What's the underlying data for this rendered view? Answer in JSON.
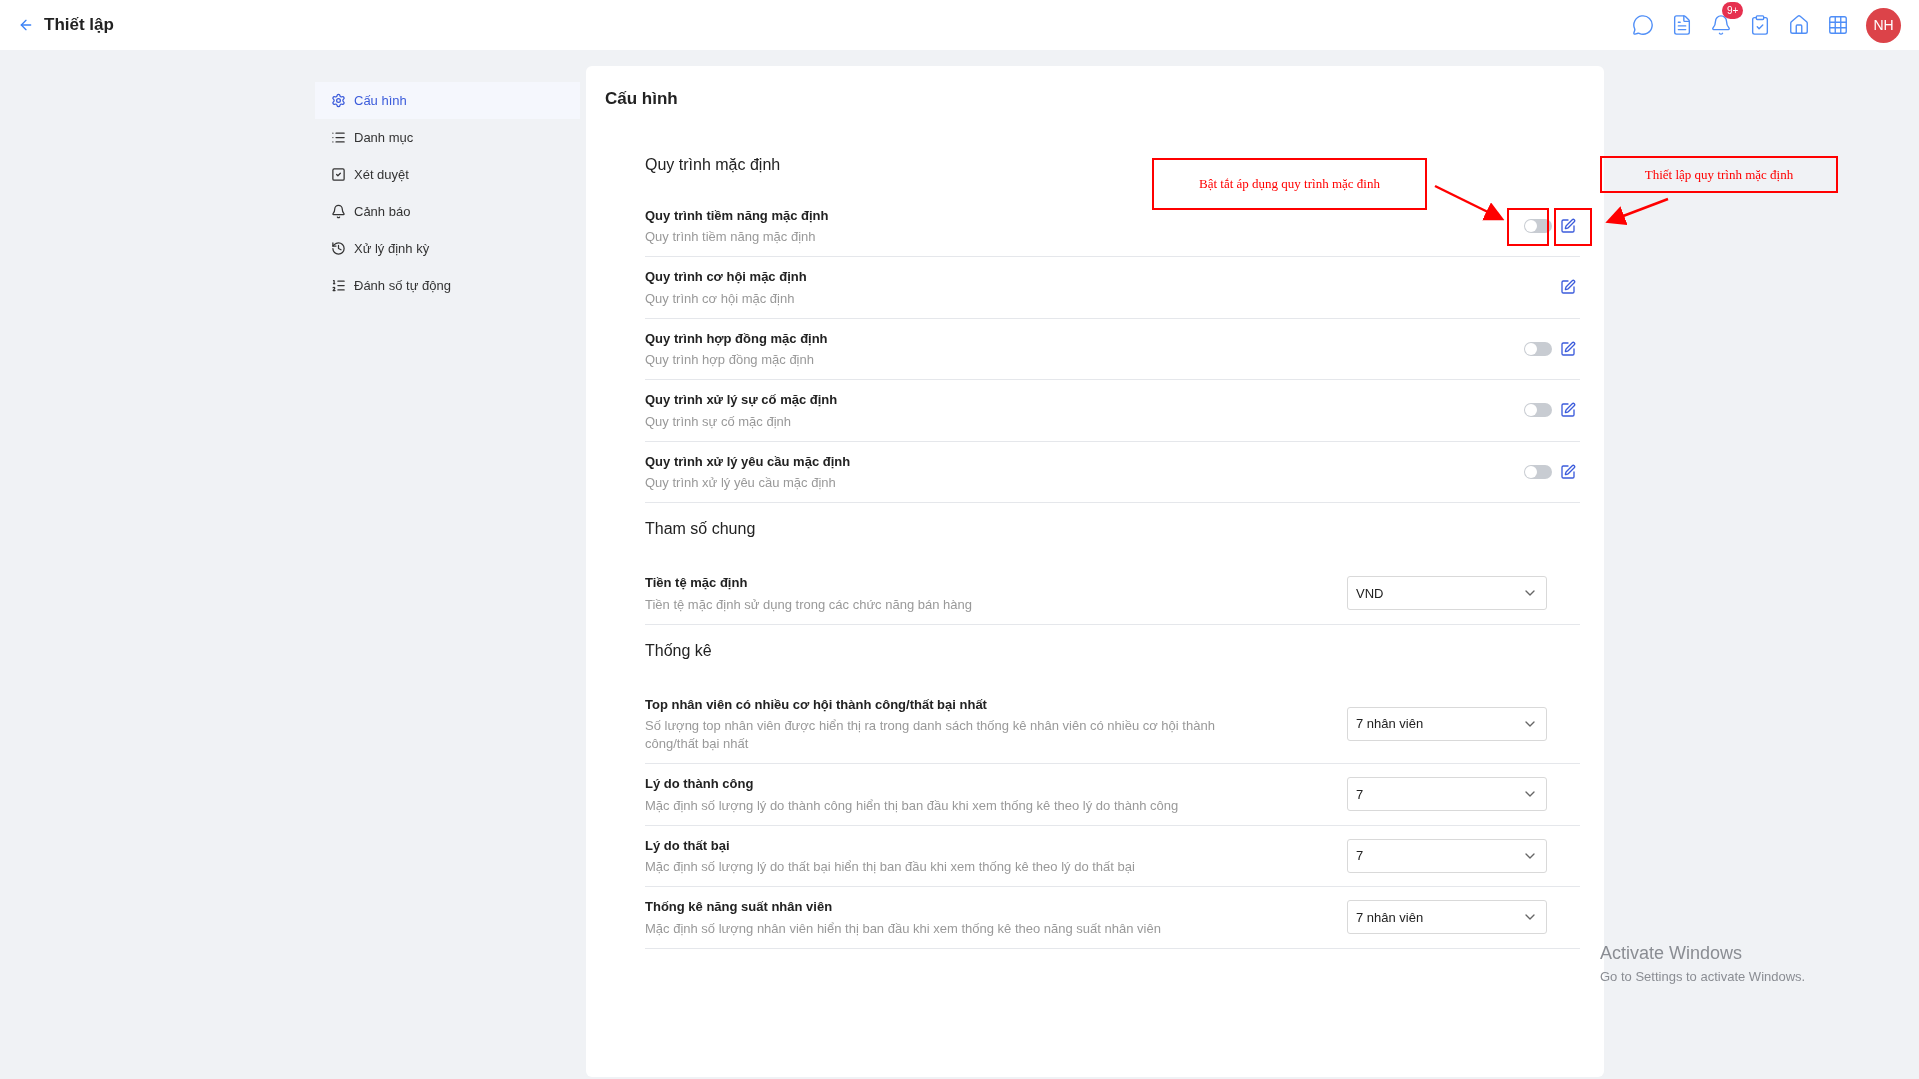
{
  "header": {
    "title": "Thiết lập",
    "notification_badge": "9+",
    "avatar_initials": "NH"
  },
  "sidebar": {
    "items": [
      {
        "label": "Cấu hình",
        "selected": true
      },
      {
        "label": "Danh mục",
        "selected": false
      },
      {
        "label": "Xét duyệt",
        "selected": false
      },
      {
        "label": "Cảnh báo",
        "selected": false
      },
      {
        "label": "Xử lý định kỳ",
        "selected": false
      },
      {
        "label": "Đánh số tự động",
        "selected": false
      }
    ]
  },
  "panel": {
    "title": "Cấu hình",
    "sections": [
      {
        "title": "Quy trình mặc định",
        "rows": [
          {
            "kind": "toggle_edit",
            "label": "Quy trình tiềm năng mặc định",
            "description": "Quy trình tiềm năng mặc định",
            "on": false
          },
          {
            "kind": "edit",
            "label": "Quy trình cơ hội mặc định",
            "description": "Quy trình cơ hội mặc định"
          },
          {
            "kind": "toggle_edit",
            "label": "Quy trình hợp đồng mặc định",
            "description": "Quy trình hợp đồng mặc định",
            "on": false
          },
          {
            "kind": "toggle_edit",
            "label": "Quy trình xử lý sự cố mặc định",
            "description": "Quy trình sự cố mặc định",
            "on": false
          },
          {
            "kind": "toggle_edit",
            "label": "Quy trình xử lý yêu cầu mặc định",
            "description": "Quy trình xử lý yêu cầu mặc định",
            "on": false
          }
        ]
      },
      {
        "title": "Tham số chung",
        "rows": [
          {
            "kind": "select",
            "label": "Tiền tệ mặc định",
            "description": "Tiền tệ mặc định sử dụng trong các chức năng bán hàng",
            "value": "VND"
          }
        ]
      },
      {
        "title": "Thống kê",
        "rows": [
          {
            "kind": "select",
            "label": "Top nhân viên có nhiều cơ hội thành công/thất bại nhất",
            "description": "Số lượng top nhân viên được hiển thị ra trong danh sách thống kê nhân viên có nhiều cơ hội thành công/thất bại nhất",
            "value": "7 nhân viên"
          },
          {
            "kind": "select",
            "label": "Lý do thành công",
            "description": "Mặc định số lượng lý do thành công hiển thị ban đầu khi xem thống kê theo lý do thành công",
            "value": "7"
          },
          {
            "kind": "select",
            "label": "Lý do thất bại",
            "description": "Mặc định số lượng lý do thất bại hiển thị ban đầu khi xem thống kê theo lý do thất bại",
            "value": "7"
          },
          {
            "kind": "select",
            "label": "Thống kê năng suất nhân viên",
            "description": "Mặc định số lượng nhân viên hiển thị ban đầu khi xem thống kê theo năng suất nhân viên",
            "value": "7 nhân viên"
          }
        ]
      }
    ]
  },
  "annotations": [
    {
      "text": "Bật tắt áp dụng quy trình mặc đinh"
    },
    {
      "text": "Thiết lập quy trình mặc định"
    }
  ],
  "activation": {
    "title": "Activate Windows",
    "subtitle": "Go to Settings to activate Windows."
  }
}
